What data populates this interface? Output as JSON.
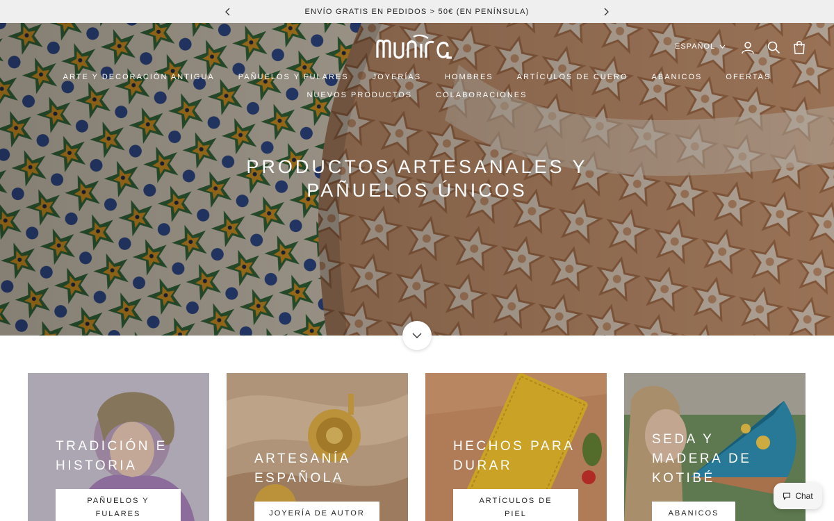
{
  "announcement": {
    "text": "ENVÍO GRATIS EN PEDIDOS > 50€ (EN PENÍNSULA)"
  },
  "header": {
    "logo_text": "munira",
    "language": "ESPAÑOL"
  },
  "nav": {
    "items": [
      "ARTE Y DECORACIÓN ANTIGUA",
      "PAÑUELOS Y FULARES",
      "JOYERÍAS",
      "HOMBRES",
      "ARTÍCULOS DE CUERO",
      "ABANICOS",
      "OFERTAS",
      "NUEVOS PRODUCTOS",
      "COLABORACIONES"
    ]
  },
  "hero": {
    "title_line1": "PRODUCTOS ARTESANALES Y",
    "title_line2": "PAÑUELOS ÚNICOS"
  },
  "cards": [
    {
      "title_line1": "TRADICIÓN E",
      "title_line2": "HISTORIA",
      "title_line3": "",
      "button_line1": "PAÑUELOS Y",
      "button_line2": "FULARES"
    },
    {
      "title_line1": "ARTESANÍA",
      "title_line2": "ESPAÑOLA",
      "title_line3": "",
      "button_line1": "JOYERÍA DE AUTOR",
      "button_line2": ""
    },
    {
      "title_line1": "HECHOS PARA",
      "title_line2": "DURAR",
      "title_line3": "",
      "button_line1": "ARTÍCULOS DE",
      "button_line2": "PIEL"
    },
    {
      "title_line1": "SEDA Y",
      "title_line2": "MADERA DE",
      "title_line3": "KOTIBÉ",
      "button_line1": "ABANICOS",
      "button_line2": ""
    }
  ],
  "chat": {
    "label": "Chat"
  },
  "colors": {
    "announcement_bg": "#efefef",
    "hero_text": "#ffffff",
    "button_bg": "#ffffff"
  }
}
